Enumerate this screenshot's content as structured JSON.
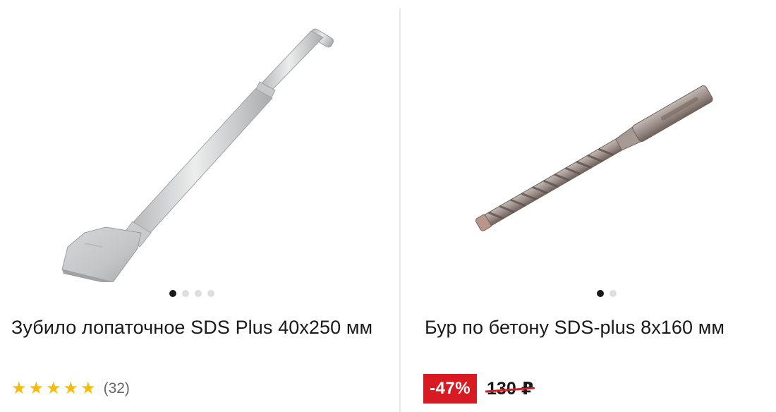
{
  "products": [
    {
      "title": "Зубило лопаточное SDS Plus 40х250 мм",
      "image_icon": "chisel-image",
      "gallery": {
        "count": 4,
        "active": 1
      },
      "rating": {
        "stars": 5,
        "reviews": "(32)"
      }
    },
    {
      "title": "Бур по бетону SDS-plus 8х160 мм",
      "image_icon": "drill-bit-image",
      "gallery": {
        "count": 2,
        "active": 1
      },
      "discount": "-47%",
      "old_price": "130 ₽"
    }
  ],
  "colors": {
    "star": "#f7bc0b",
    "discount_badge": "#d81b22",
    "strike": "#d81b22",
    "dot_active": "#1a1a1a",
    "dot_inactive": "#dedede"
  }
}
